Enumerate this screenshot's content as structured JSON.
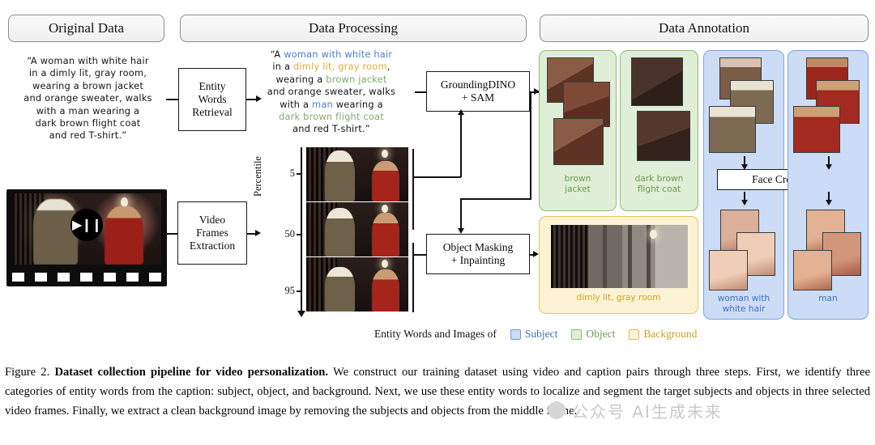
{
  "headers": {
    "original": "Original Data",
    "processing": "Data Processing",
    "annotation": "Data Annotation"
  },
  "original_caption": {
    "full": "“A woman with white hair in a dimly lit, gray room, wearing a brown jacket and orange sweater, walks with a man wearing a dark brown flight coat and red T-shirt.”",
    "lines": [
      "“A woman with white hair",
      "in a dimly lit, gray room,",
      "wearing a brown jacket",
      "and orange sweater, walks",
      "with a man wearing a",
      "dark brown flight coat",
      "and red T-shirt.”"
    ]
  },
  "processed_caption": {
    "segments": [
      {
        "text": "“A ",
        "type": "plain"
      },
      {
        "text": "woman with white hair",
        "type": "subject"
      },
      {
        "text": " in a ",
        "type": "plain"
      },
      {
        "text": "dimly lit, gray room",
        "type": "background"
      },
      {
        "text": ", wearing a ",
        "type": "plain"
      },
      {
        "text": "brown jacket",
        "type": "object"
      },
      {
        "text": " and orange sweater, walks with a ",
        "type": "plain"
      },
      {
        "text": "man",
        "type": "subject"
      },
      {
        "text": " wearing a ",
        "type": "plain"
      },
      {
        "text": "dark brown flight coat",
        "type": "object"
      },
      {
        "text": " and red T-shirt.”",
        "type": "plain"
      }
    ],
    "line1_a": "“A ",
    "line1_b": "woman with white hair",
    "line2_a": "in a ",
    "line2_b": "dimly lit, gray room",
    "line2_c": ",",
    "line3_a": "wearing a ",
    "line3_b": "brown jacket",
    "line4": "and orange sweater, walks",
    "line5_a": "with a ",
    "line5_b": "man",
    "line5_c": " wearing a",
    "line6": "dark brown flight coat",
    "line7": "and red T-shirt.”"
  },
  "boxes": {
    "entity_words_retrieval": "Entity\nWords\nRetrieval",
    "entity_words_retrieval_lines": [
      "Entity",
      "Words",
      "Retrieval"
    ],
    "video_frames_extraction_lines": [
      "Video",
      "Frames",
      "Extraction"
    ],
    "grounding_dino_lines": [
      "GroundingDINO",
      "+ SAM"
    ],
    "object_masking_lines": [
      "Object Masking",
      "+ Inpainting"
    ],
    "face_cropping": "Face Cropping"
  },
  "axis": {
    "label": "Percentile",
    "ticks": [
      "5",
      "50",
      "95"
    ]
  },
  "video": {
    "play_icon": "▶❙❙"
  },
  "panels": {
    "object": [
      {
        "label_lines": [
          "brown",
          "jacket"
        ],
        "label": "brown jacket"
      },
      {
        "label_lines": [
          "dark brown",
          "flight coat"
        ],
        "label": "dark brown flight coat"
      }
    ],
    "subject": [
      {
        "label_lines": [
          "woman with",
          "white hair"
        ],
        "label": "woman with white hair"
      },
      {
        "label_lines": [
          "man"
        ],
        "label": "man"
      }
    ],
    "background": {
      "label": "dimly lit, gray room"
    }
  },
  "legend": {
    "prefix": "Entity Words and Images of",
    "items": [
      {
        "name": "Subject",
        "color": "#3f6fc6",
        "swatch": "#ccdcf7"
      },
      {
        "name": "Object",
        "color": "#6d9a56",
        "swatch": "#dfeed6"
      },
      {
        "name": "Background",
        "color": "#cf9e22",
        "swatch": "#fcf3d5"
      }
    ]
  },
  "figure_caption": {
    "number": "Figure 2.",
    "title": "Dataset collection pipeline for video personalization.",
    "body": "We construct our training dataset using video and caption pairs through three steps. First, we identify three categories of entity words from the caption: subject, object, and background. Next, we use these entity words to localize and segment the target subjects and objects in three selected video frames. Finally, we extract a clean background image by removing the subjects and objects from the middle frame."
  },
  "watermark": {
    "text": "公众号  AI生成未来"
  }
}
